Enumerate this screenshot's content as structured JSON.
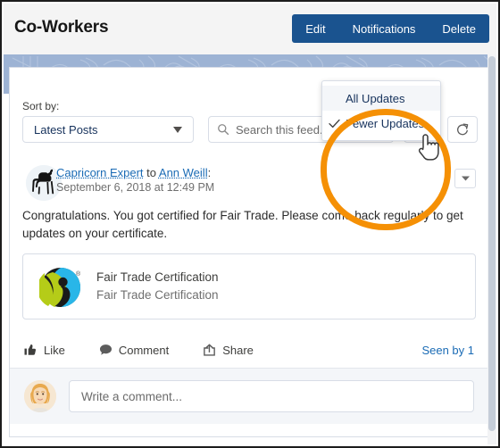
{
  "header": {
    "title": "Co-Workers",
    "actions": [
      {
        "label": "Edit",
        "name": "edit-button"
      },
      {
        "label": "Notifications",
        "name": "notifications-button"
      },
      {
        "label": "Delete",
        "name": "delete-button"
      }
    ],
    "accent_color": "#1a538f"
  },
  "banner": {
    "color": "#9db3d4"
  },
  "toolbar": {
    "sort_label": "Sort by:",
    "sort_value": "Latest Posts",
    "sort_options": [
      "Latest Posts"
    ],
    "search_placeholder": "Search this feed...",
    "search_value": "",
    "filter_icon": "filter-funnel-icon",
    "refresh_icon": "refresh-icon"
  },
  "filter_menu": {
    "open": true,
    "items": [
      {
        "label": "All Updates",
        "checked": false,
        "hovered": true
      },
      {
        "label": "Fewer Updates",
        "checked": true,
        "hovered": false
      }
    ]
  },
  "post": {
    "author": "Capricorn Expert",
    "connector": " to ",
    "recipient": "Ann Weill",
    "colon": ":",
    "timestamp": "September 6, 2018 at 12:49 PM",
    "avatar_icon": "goat-avatar-icon",
    "menu_icon": "chevron-down-icon",
    "body": "Congratulations. You got certified for Fair Trade. Please come back regularly to get updates on your certificate.",
    "attachment": {
      "title": "Fair Trade Certification",
      "subtitle": "Fair Trade Certification",
      "logo_icon": "fairtrade-logo-icon",
      "logo_colors": {
        "cyan": "#29b6e8",
        "green": "#b5cc18",
        "black": "#1a1a1a"
      }
    },
    "actions": [
      {
        "label": "Like",
        "icon": "thumbs-up-icon",
        "name": "like-button"
      },
      {
        "label": "Comment",
        "icon": "comment-bubble-icon",
        "name": "comment-button"
      },
      {
        "label": "Share",
        "icon": "share-arrow-icon",
        "name": "share-button"
      }
    ],
    "seen_by": "Seen by 1"
  },
  "composer": {
    "placeholder": "Write a comment...",
    "value": "",
    "avatar_icon": "user-avatar-icon"
  },
  "annotation": {
    "highlight_color": "#f59005",
    "cursor_icon": "pointing-hand-cursor"
  }
}
